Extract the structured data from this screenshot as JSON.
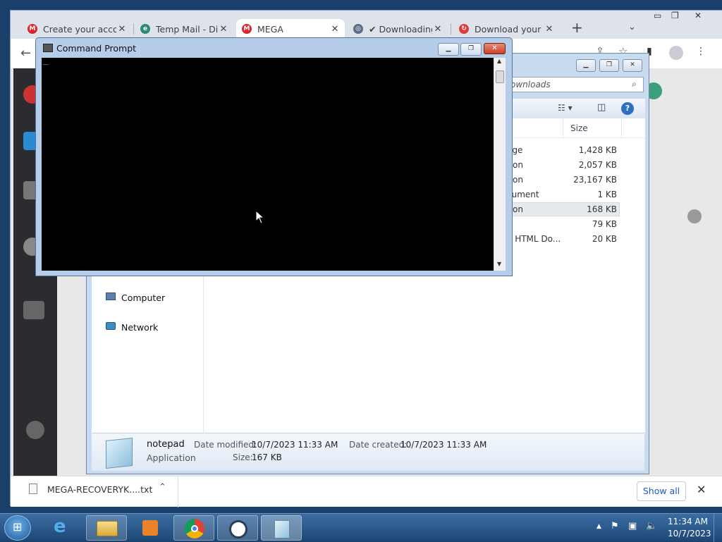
{
  "browser": {
    "tabs": [
      {
        "title": "Create your acco",
        "active": false
      },
      {
        "title": "Temp Mail - Disp",
        "active": false
      },
      {
        "title": "MEGA",
        "active": true
      },
      {
        "title": "✔ Downloading",
        "active": false
      },
      {
        "title": "Download your f",
        "active": false
      }
    ],
    "new_tab_symbol": "+",
    "download_bar": {
      "file_name": "MEGA-RECOVERYK....txt",
      "show_all_label": "Show all"
    }
  },
  "cmd": {
    "title": "Command Prompt",
    "cursor": "_"
  },
  "explorer": {
    "search_text": "ownloads",
    "column_size": "Size",
    "rows": [
      {
        "type": "age",
        "size": "1,428 KB"
      },
      {
        "type": "tion",
        "size": "2,057 KB"
      },
      {
        "type": "tion",
        "size": "23,167 KB"
      },
      {
        "type": "cument",
        "size": "1 KB"
      },
      {
        "type": "tion",
        "size": "168 KB"
      },
      {
        "type": "",
        "size": "79 KB"
      },
      {
        "type": "e HTML Do...",
        "size": "20 KB"
      }
    ],
    "nav": [
      {
        "label": "Computer"
      },
      {
        "label": "Network"
      }
    ],
    "details": {
      "name": "notepad",
      "kind": "Application",
      "date_modified_label": "Date modified:",
      "date_modified": "10/7/2023 11:33 AM",
      "size_label": "Size:",
      "size": "167 KB",
      "date_created_label": "Date created:",
      "date_created": "10/7/2023 11:33 AM"
    }
  },
  "taskbar": {
    "time": "11:34 AM",
    "date": "10/7/2023"
  }
}
